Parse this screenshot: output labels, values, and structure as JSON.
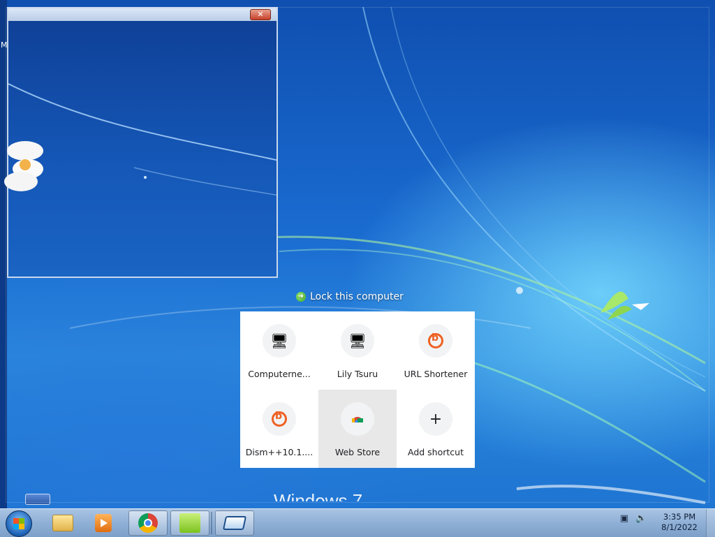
{
  "window": {
    "close_symbol": "✕"
  },
  "left_strip": {
    "letter": "M"
  },
  "lock": {
    "label": "Lock this computer",
    "icon": "green-arrow-icon"
  },
  "shortcuts": [
    {
      "label": "Computerne...",
      "icon": "computer-icon"
    },
    {
      "label": "Lily Tsuru",
      "icon": "computer-icon"
    },
    {
      "label": "URL Shortener",
      "icon": "bitly-icon"
    },
    {
      "label": "Dism++10.1....",
      "icon": "bitly-icon"
    },
    {
      "label": "Web Store",
      "icon": "chrome-web-store-icon"
    },
    {
      "label": "Add shortcut",
      "icon": "plus-icon"
    }
  ],
  "watermark": {
    "text": "Windows 7"
  },
  "taskbar": {
    "items": [
      {
        "name": "explorer",
        "icon": "folder-icon"
      },
      {
        "name": "media-player",
        "icon": "media-player-icon"
      },
      {
        "name": "chrome",
        "icon": "chrome-icon"
      },
      {
        "name": "green-app",
        "icon": "green-app-icon"
      },
      {
        "name": "remote-desktop",
        "icon": "remote-desktop-icon"
      }
    ]
  },
  "tray": {
    "network_icon": "network-icon",
    "volume_icon": "volume-icon",
    "time": "3:35 PM",
    "date": "8/1/2022"
  },
  "colors": {
    "taskbar": "#8fb0d6",
    "panel": "#ffffff",
    "hover_tile": "#e8e8e8",
    "bitly_orange": "#ee6123"
  }
}
